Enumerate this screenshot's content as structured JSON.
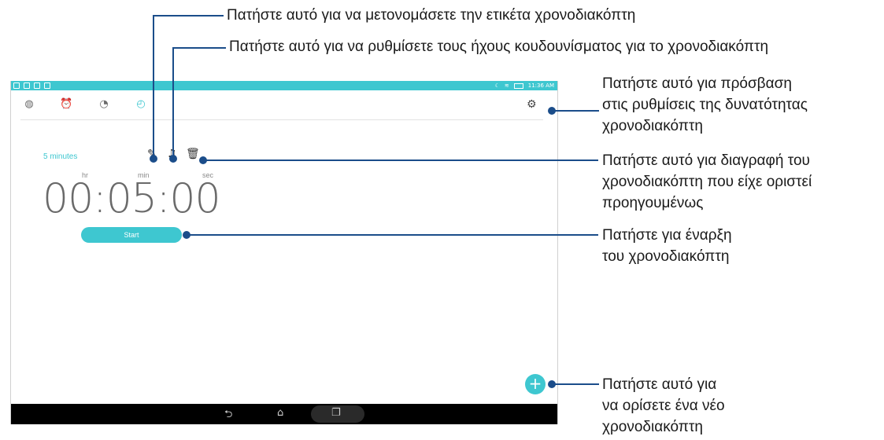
{
  "status_bar": {
    "time": "11:36 AM"
  },
  "tabs": [
    {
      "name": "world-clock",
      "icon": "globe-icon"
    },
    {
      "name": "alarm",
      "icon": "alarm-clock-icon"
    },
    {
      "name": "stopwatch",
      "icon": "stopwatch-icon"
    },
    {
      "name": "timer",
      "icon": "timer-icon",
      "active": true
    }
  ],
  "timer": {
    "label": "5 minutes",
    "units": {
      "hr": "hr",
      "min": "min",
      "sec": "sec"
    },
    "time": "00:05:00",
    "start_label": "Start"
  },
  "callouts": {
    "rename": "Πατήστε αυτό για να μετονομάσετε την ετικέτα χρονοδιακόπτη",
    "ringtone": "Πατήστε αυτό για να ρυθμίσετε τους ήχους κουδουνίσματος για το χρονοδιακόπτη",
    "settings": [
      "Πατήστε αυτό για πρόσβαση",
      "στις ρυθμίσεις της δυνατότητας",
      "χρονοδιακόπτη"
    ],
    "delete": [
      "Πατήστε αυτό για διαγραφή του",
      "χρονοδιακόπτη που είχε οριστεί",
      "προηγουμένως"
    ],
    "start": [
      "Πατήστε για έναρξη",
      "του χρονοδιακόπτη"
    ],
    "add": [
      "Πατήστε αυτό για",
      "να ορίσετε ένα νέο",
      "χρονοδιακόπτη"
    ]
  },
  "colors": {
    "accent": "#3ec7d0",
    "callout_line": "#1b4d8a"
  }
}
